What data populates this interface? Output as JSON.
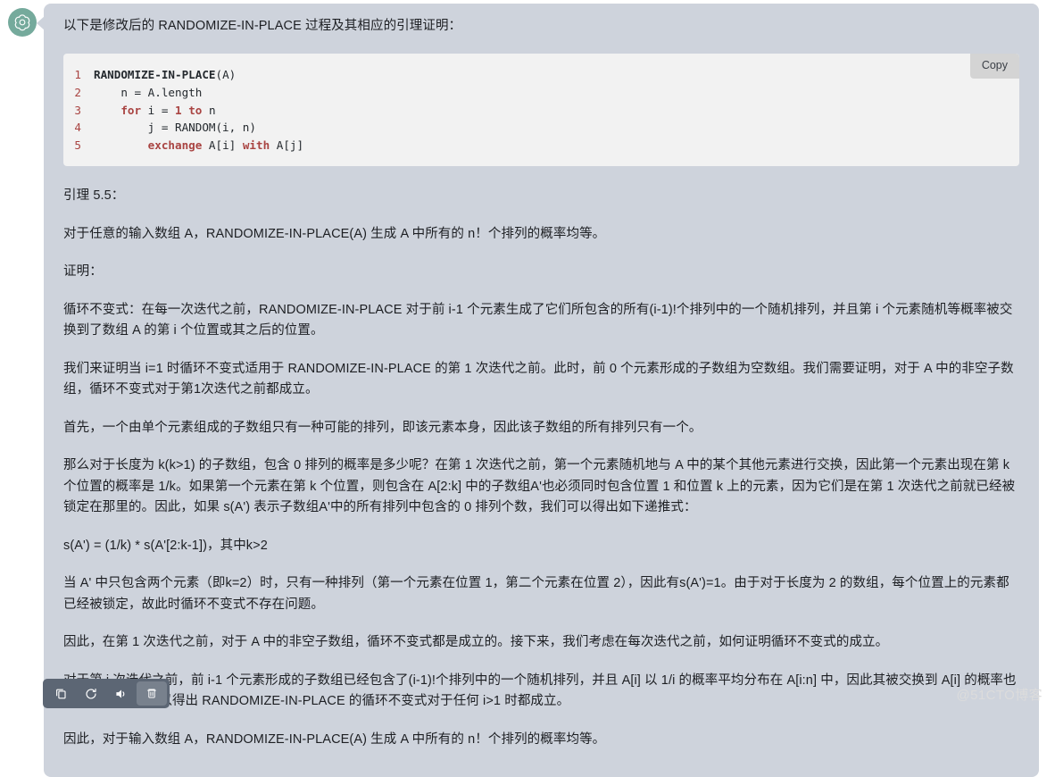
{
  "avatar": {
    "icon": "openai-logo-icon",
    "bg": "#75aa9c"
  },
  "code_block": {
    "copy_label": "Copy",
    "language": "pseudocode",
    "lines": [
      {
        "n": "1",
        "text": "RANDOMIZE-IN-PLACE(A)"
      },
      {
        "n": "2",
        "text": "    n = A.length"
      },
      {
        "n": "3",
        "text": "    for i = 1 to n"
      },
      {
        "n": "4",
        "text": "        j = RANDOM(i, n)"
      },
      {
        "n": "5",
        "text": "        exchange A[i] with A[j]"
      }
    ]
  },
  "message": {
    "intro": "以下是修改后的 RANDOMIZE-IN-PLACE 过程及其相应的引理证明：",
    "paragraphs": [
      "引理 5.5：",
      "对于任意的输入数组 A，RANDOMIZE-IN-PLACE(A) 生成 A 中所有的 n！个排列的概率均等。",
      "证明：",
      "循环不变式：在每一次迭代之前，RANDOMIZE-IN-PLACE 对于前 i-1 个元素生成了它们所包含的所有(i-1)!个排列中的一个随机排列，并且第 i 个元素随机等概率被交换到了数组 A 的第 i 个位置或其之后的位置。",
      "我们来证明当 i=1 时循环不变式适用于 RANDOMIZE-IN-PLACE 的第 1 次迭代之前。此时，前 0 个元素形成的子数组为空数组。我们需要证明，对于 A 中的非空子数组，循环不变式对于第1次迭代之前都成立。",
      "首先，一个由单个元素组成的子数组只有一种可能的排列，即该元素本身，因此该子数组的所有排列只有一个。",
      "那么对于长度为 k(k>1) 的子数组，包含 0 排列的概率是多少呢？在第 1 次迭代之前，第一个元素随机地与 A 中的某个其他元素进行交换，因此第一个元素出现在第 k 个位置的概率是 1/k。如果第一个元素在第 k 个位置，则包含在 A[2:k] 中的子数组A'也必须同时包含位置 1 和位置 k 上的元素，因为它们是在第 1 次迭代之前就已经被锁定在那里的。因此，如果 s(A') 表示子数组A'中的所有排列中包含的 0 排列个数，我们可以得出如下递推式：",
      "s(A') = (1/k) * s(A'[2:k-1])，其中k>2",
      "当 A' 中只包含两个元素（即k=2）时，只有一种排列（第一个元素在位置 1，第二个元素在位置 2），因此有s(A')=1。由于对于长度为 2 的数组，每个位置上的元素都已经被锁定，故此时循环不变式不存在问题。",
      "因此，在第 1 次迭代之前，对于 A 中的非空子数组，循环不变式都是成立的。接下来，我们考虑在每次迭代之前，如何证明循环不变式的成立。",
      "对于第 i 次迭代之前，前 i-1 个元素形成的子数组已经包含了(i-1)!个排列中的一个随机排列，并且 A[i] 以 1/i 的概率平均分布在 A[i:n] 中，因此其被交换到 A[i] 的概率也是 1/i。由此，可以得出 RANDOMIZE-IN-PLACE 的循环不变式对于任何 i>1 时都成立。",
      "因此，对于输入数组 A，RANDOMIZE-IN-PLACE(A) 生成 A 中所有的 n！个排列的概率均等。"
    ]
  },
  "action_bar": {
    "buttons": [
      {
        "name": "copy-icon",
        "label": "Copy",
        "active": false
      },
      {
        "name": "regenerate-icon",
        "label": "Regenerate",
        "active": false
      },
      {
        "name": "speaker-icon",
        "label": "Read aloud",
        "active": false
      },
      {
        "name": "trash-icon",
        "label": "Delete",
        "active": true
      }
    ]
  },
  "watermark": {
    "text": "@51CTO博客"
  },
  "colors": {
    "bubble_bg": "#ced3dc",
    "code_bg": "#f2f2f2",
    "copy_btn_bg": "#d4d4d4",
    "toolbar_bg": "#5c6674",
    "accent_red": "#a94442"
  }
}
